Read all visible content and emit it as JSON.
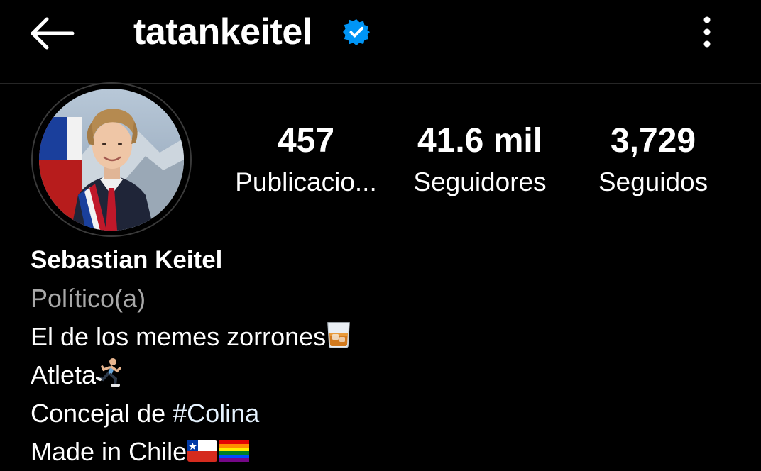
{
  "header": {
    "back_icon": "arrow-left-icon",
    "username": "tatankeitel",
    "verified_icon": "verified-badge-icon",
    "more_icon": "vertical-dots-icon"
  },
  "profile": {
    "avatar": "profile-photo",
    "stats": {
      "posts": {
        "value": "457",
        "label": "Publicacio..."
      },
      "followers": {
        "value": "41.6 mil",
        "label": "Seguidores"
      },
      "following": {
        "value": "3,729",
        "label": "Seguidos"
      }
    }
  },
  "bio": {
    "full_name": "Sebastian Keitel",
    "category": "Político(a)",
    "line1": "El de los memes zorrones",
    "line2": "Atleta",
    "line3_prefix": "Concejal de ",
    "line3_hashtag": "#Colina",
    "line4": "Made in Chile",
    "emojis": {
      "line1": "whisky-glass-emoji",
      "line2": "runner-emoji",
      "line4": [
        "chile-flag-emoji",
        "rainbow-flag-emoji"
      ]
    }
  },
  "colors": {
    "background": "#000000",
    "text": "#ffffff",
    "secondary_text": "#a8a8a8",
    "verified_blue": "#0095f6",
    "hashtag": "#e6f3ff",
    "divider": "#262626"
  }
}
